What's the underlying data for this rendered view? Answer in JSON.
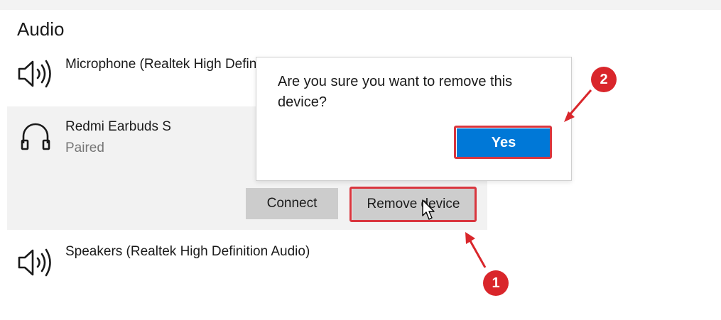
{
  "section": {
    "title": "Audio"
  },
  "devices": [
    {
      "icon": "speaker-icon",
      "name": "Microphone (Realtek High Definition Audio)",
      "status": ""
    },
    {
      "icon": "headphones-icon",
      "name": "Redmi Earbuds S",
      "status": "Paired"
    },
    {
      "icon": "speaker-icon",
      "name": "Speakers (Realtek High Definition Audio)",
      "status": ""
    }
  ],
  "actions": {
    "connect_label": "Connect",
    "remove_label": "Remove device"
  },
  "dialog": {
    "message": "Are you sure you want to remove this device?",
    "yes_label": "Yes"
  },
  "annotations": {
    "step1": "1",
    "step2": "2"
  },
  "colors": {
    "accent": "#0078d7",
    "annotation": "#d9262b",
    "selected_bg": "#f2f2f2"
  }
}
